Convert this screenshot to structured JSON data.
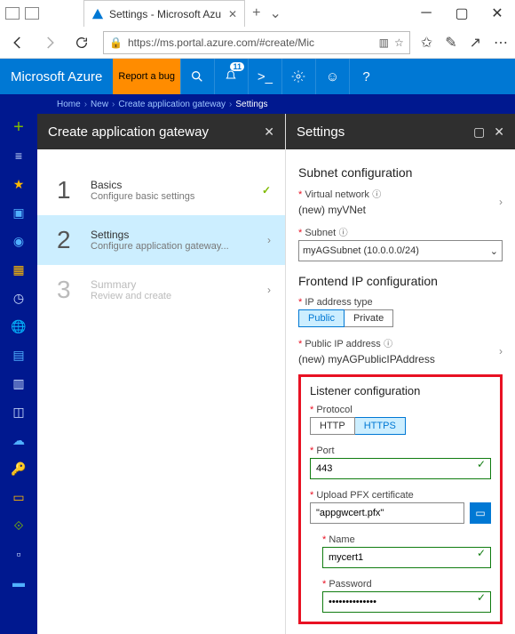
{
  "window": {
    "tab_title": "Settings - Microsoft Azu",
    "url_display": "https://ms.portal.azure.com/#create/Mic",
    "url_host_bold": "ms.portal.azure.com"
  },
  "azure_bar": {
    "brand": "Microsoft Azure",
    "report": "Report a bug",
    "notif_count": "11"
  },
  "breadcrumb": {
    "items": [
      "Home",
      "New",
      "Create application gateway",
      "Settings"
    ]
  },
  "blade1": {
    "title": "Create application gateway",
    "steps": [
      {
        "num": "1",
        "title": "Basics",
        "sub": "Configure basic settings"
      },
      {
        "num": "2",
        "title": "Settings",
        "sub": "Configure application gateway..."
      },
      {
        "num": "3",
        "title": "Summary",
        "sub": "Review and create"
      }
    ]
  },
  "blade2": {
    "title": "Settings",
    "subnet_section": "Subnet configuration",
    "vnet_label": "Virtual network",
    "vnet_value": "(new) myVNet",
    "subnet_label": "Subnet",
    "subnet_value": "myAGSubnet (10.0.0.0/24)",
    "frontend_section": "Frontend IP configuration",
    "iptype_label": "IP address type",
    "iptype_public": "Public",
    "iptype_private": "Private",
    "pubip_label": "Public IP address",
    "pubip_value": "(new) myAGPublicIPAddress",
    "listener_section": "Listener configuration",
    "proto_label": "Protocol",
    "proto_http": "HTTP",
    "proto_https": "HTTPS",
    "port_label": "Port",
    "port_value": "443",
    "upload_label": "Upload PFX certificate",
    "upload_value": "\"appgwcert.pfx\"",
    "cert_name_label": "Name",
    "cert_name_value": "mycert1",
    "cert_pw_label": "Password",
    "cert_pw_value": "••••••••••••••"
  }
}
